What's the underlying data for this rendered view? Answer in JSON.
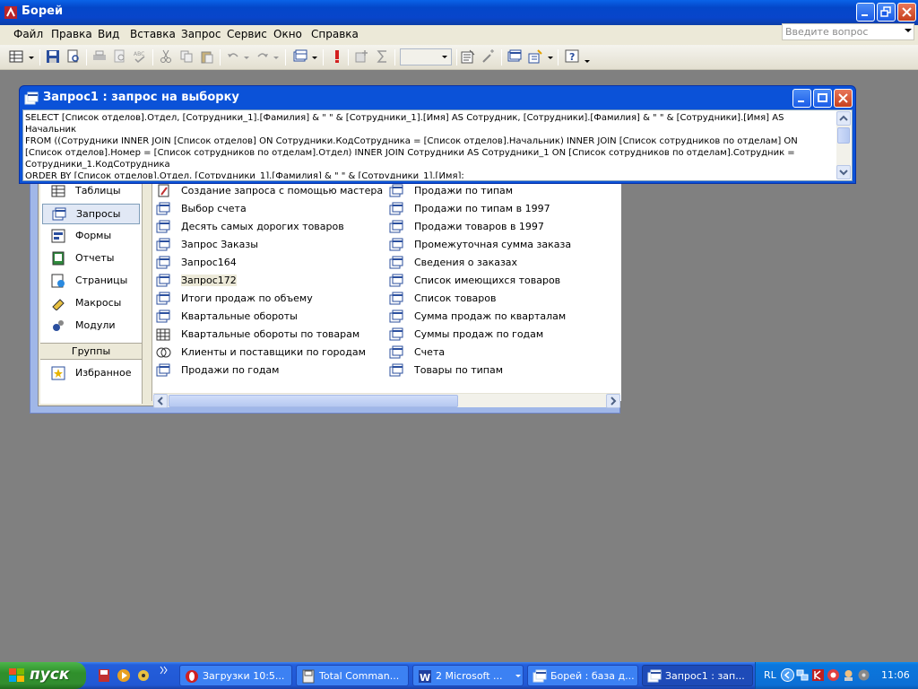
{
  "app": {
    "title": "Борей",
    "ask_placeholder": "Введите вопрос"
  },
  "menu": [
    "Файл",
    "Правка",
    "Вид",
    "Вставка",
    "Запрос",
    "Сервис",
    "Окно",
    "Справка"
  ],
  "query_window": {
    "title": "Запрос1 : запрос на выборку",
    "sql": "SELECT [Список отделов].Отдел, [Сотрудники_1].[Фамилия] & \" \" & [Сотрудники_1].[Имя] AS Сотрудник, [Сотрудники].[Фамилия] & \" \" & [Сотрудники].[Имя] AS Начальник\nFROM ((Сотрудники INNER JOIN [Список отделов] ON Сотрудники.КодСотрудника = [Список отделов].Начальник) INNER JOIN [Список сотрудников по отделам] ON [Список отделов].Номер = [Список сотрудников по отделам].Отдел) INNER JOIN Сотрудники AS Сотрудники_1 ON [Список сотрудников по отделам].Сотрудник = Сотрудники_1.КодСотрудника\nORDER BY [Список отделов].Отдел, [Сотрудники_1].[Фамилия] & \" \" & [Сотрудники_1].[Имя];"
  },
  "db_window": {
    "objects": [
      {
        "label": "Таблицы"
      },
      {
        "label": "Запросы"
      },
      {
        "label": "Формы"
      },
      {
        "label": "Отчеты"
      },
      {
        "label": "Страницы"
      },
      {
        "label": "Макросы"
      },
      {
        "label": "Модули"
      }
    ],
    "groups_header": "Группы",
    "favorites": "Избранное",
    "items_col1": [
      "Создание запроса с помощью мастера",
      "Выбор счета",
      "Десять самых дорогих товаров",
      "Запрос Заказы",
      "Запрос164",
      "Запрос172",
      "Итоги продаж по объему",
      "Квартальные обороты",
      "Квартальные обороты по товарам",
      "Клиенты и поставщики по городам",
      "Продажи по годам"
    ],
    "items_col2": [
      "Продажи по типам",
      "Продажи по типам в 1997",
      "Продажи товаров в 1997",
      "Промежуточная сумма заказа",
      "Сведения о заказах",
      "Список имеющихся товаров",
      "Список товаров",
      "Сумма продаж по кварталам",
      "Суммы продаж по годам",
      "Счета",
      "Товары по типам"
    ]
  },
  "taskbar": {
    "start": "пуск",
    "tasks": [
      "Загрузки 10:5...",
      "Total Comman...",
      "2 Microsoft ...",
      "Борей : база д...",
      "Запрос1 : зап..."
    ],
    "lang": "RL",
    "clock": "11:06"
  },
  "colors": {
    "xp_blue": "#0b52d8",
    "desktop_gray": "#808080",
    "start_green": "#328e2f"
  }
}
